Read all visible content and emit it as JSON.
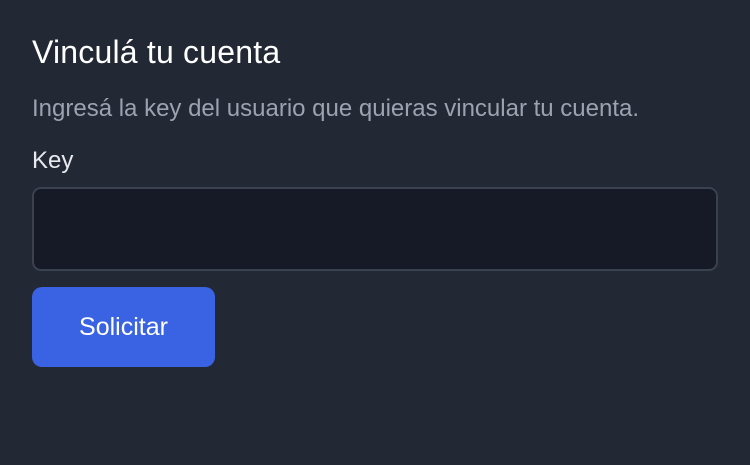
{
  "link_account": {
    "title": "Vinculá tu cuenta",
    "description": "Ingresá la key del usuario que quieras vincular tu cuenta.",
    "key_field": {
      "label": "Key",
      "value": "",
      "placeholder": ""
    },
    "submit_label": "Solicitar"
  },
  "colors": {
    "background": "#222834",
    "input_background": "#151a26",
    "input_border": "#3a414f",
    "accent": "#3a63e4",
    "muted_text": "#9ba3b0"
  }
}
